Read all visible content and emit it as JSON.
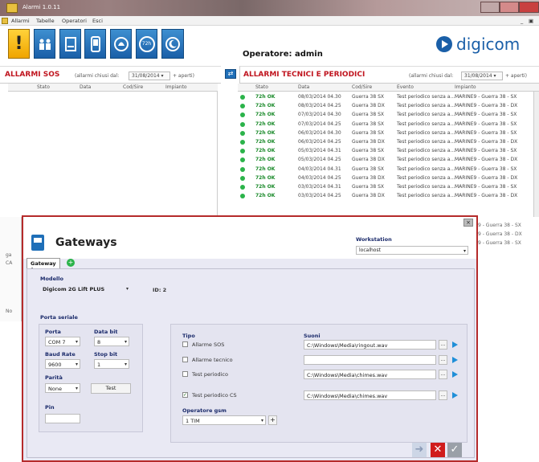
{
  "window": {
    "title": "Alarmi 1.0.11"
  },
  "menu": [
    "Allarmi",
    "Tabelle",
    "Operatori",
    "Esci"
  ],
  "toolbar_icons": [
    "warning-icon",
    "people-icon",
    "document-icon",
    "phone-icon",
    "bell-icon",
    "clock-72h-icon",
    "moon-icon"
  ],
  "toolbar_clock_text": "72h",
  "operator": "Operatore: admin",
  "logo": "digicom",
  "sos": {
    "title": "ALLARMI SOS",
    "closed_label": "(allarmi chiusi dal:",
    "date": "31/08/2014",
    "open": "+ aperti)",
    "columns": [
      "Stato",
      "Data",
      "Cod/Sire",
      "Impianto"
    ]
  },
  "tech": {
    "title": "ALLARMI TECNICI E PERIODICI",
    "closed_label": "(allarmi chiusi dal:",
    "date": "31/08/2014",
    "open": "+ aperti)",
    "columns": [
      "Stato",
      "Data",
      "Cod/Sire",
      "Evento",
      "Impianto"
    ],
    "rows": [
      {
        "stato": "72h OK",
        "data": "08/03/2014 04.30",
        "cod": "Guerra 38 SX",
        "evento": "Test periodico senza a...",
        "impianto": "MARINE9 - Guerra 38 - SX"
      },
      {
        "stato": "72h OK",
        "data": "08/03/2014 04.25",
        "cod": "Guerra 38 DX",
        "evento": "Test periodico senza a...",
        "impianto": "MARINE9 - Guerra 38 - DX"
      },
      {
        "stato": "72h OK",
        "data": "07/03/2014 04.30",
        "cod": "Guerra 38 SX",
        "evento": "Test periodico senza a...",
        "impianto": "MARINE9 - Guerra 38 - SX"
      },
      {
        "stato": "72h OK",
        "data": "07/03/2014 04.25",
        "cod": "Guerra 38 SX",
        "evento": "Test periodico senza a...",
        "impianto": "MARINE9 - Guerra 38 - SX"
      },
      {
        "stato": "72h OK",
        "data": "06/03/2014 04.30",
        "cod": "Guerra 38 SX",
        "evento": "Test periodico senza a...",
        "impianto": "MARINE9 - Guerra 38 - SX"
      },
      {
        "stato": "72h OK",
        "data": "06/03/2014 04.25",
        "cod": "Guerra 38 DX",
        "evento": "Test periodico senza a...",
        "impianto": "MARINE9 - Guerra 38 - DX"
      },
      {
        "stato": "72h OK",
        "data": "05/03/2014 04.31",
        "cod": "Guerra 38 SX",
        "evento": "Test periodico senza a...",
        "impianto": "MARINE9 - Guerra 38 - SX"
      },
      {
        "stato": "72h OK",
        "data": "05/03/2014 04.25",
        "cod": "Guerra 38 DX",
        "evento": "Test periodico senza a...",
        "impianto": "MARINE9 - Guerra 38 - DX"
      },
      {
        "stato": "72h OK",
        "data": "04/03/2014 04.31",
        "cod": "Guerra 38 SX",
        "evento": "Test periodico senza a...",
        "impianto": "MARINE9 - Guerra 38 - SX"
      },
      {
        "stato": "72h OK",
        "data": "04/03/2014 04.25",
        "cod": "Guerra 38 DX",
        "evento": "Test periodico senza a...",
        "impianto": "MARINE9 - Guerra 38 - DX"
      },
      {
        "stato": "72h OK",
        "data": "03/03/2014 04.31",
        "cod": "Guerra 38 SX",
        "evento": "Test periodico senza a...",
        "impianto": "MARINE9 - Guerra 38 - SX"
      },
      {
        "stato": "72h OK",
        "data": "03/03/2014 04.25",
        "cod": "Guerra 38 DX",
        "evento": "Test periodico senza a...",
        "impianto": "MARINE9 - Guerra 38 - DX"
      }
    ],
    "partial_impianto": [
      "9 - Guerra 38 - SX",
      "9 - Guerra 38 - DX",
      "9 - Guerra 38 - SX"
    ]
  },
  "side_fragments": {
    "ga": "ga",
    "ca": "CA",
    "no": "No"
  },
  "dialog": {
    "title": "Gateways",
    "workstation_label": "Workstation",
    "workstation_value": "localhost",
    "tab": "Gateway 1",
    "modello_label": "Modello",
    "modello_value": "Digicom 2G Lift PLUS",
    "id_label": "ID: 2",
    "porta_seriale": "Porta seriale",
    "porta_label": "Porta",
    "porta_value": "COM 7",
    "databit_label": "Data bit",
    "databit_value": "8",
    "baud_label": "Baud Rate",
    "baud_value": "9600",
    "stopbit_label": "Stop bit",
    "stopbit_value": "1",
    "parita_label": "Parità",
    "parita_value": "None",
    "test_button": "Test",
    "pin_label": "Pin",
    "tipo_label": "Tipo",
    "suoni_label": "Suoni",
    "tipo_items": [
      {
        "label": "Allarme SOS",
        "checked": false,
        "sound": "C:\\Windows\\Media\\ringout.wav"
      },
      {
        "label": "Allarme tecnico",
        "checked": false,
        "sound": ""
      },
      {
        "label": "Test periodico",
        "checked": false,
        "sound": "C:\\Windows\\Media\\chimes.wav"
      },
      {
        "label": "Test periodico CS",
        "checked": true,
        "sound": "C:\\Windows\\Media\\chimes.wav"
      }
    ],
    "browse": "...",
    "operatore_label": "Operatore gsm",
    "operatore_value": "1 TIM",
    "add": "+"
  }
}
